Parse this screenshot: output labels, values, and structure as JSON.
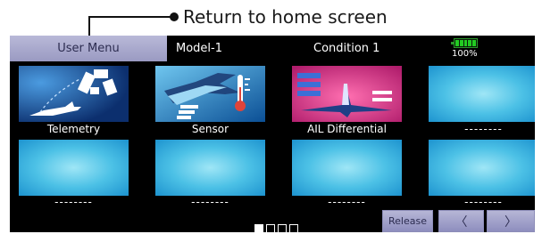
{
  "callout": {
    "text": "Return to home screen"
  },
  "header": {
    "user_menu": "User Menu",
    "model": "Model-1",
    "condition": "Condition 1",
    "battery_percent": "100%",
    "battery_level": 1.0
  },
  "tiles": [
    {
      "label": "Telemetry",
      "icon": "telemetry-icon"
    },
    {
      "label": "Sensor",
      "icon": "sensor-icon"
    },
    {
      "label": "AIL Differential",
      "icon": "ail-differential-icon"
    },
    {
      "label": "--------",
      "icon": ""
    },
    {
      "label": "--------",
      "icon": ""
    },
    {
      "label": "--------",
      "icon": ""
    },
    {
      "label": "--------",
      "icon": ""
    },
    {
      "label": "--------",
      "icon": ""
    }
  ],
  "pager": {
    "pages": 4,
    "current": 1
  },
  "buttons": {
    "release": "Release",
    "prev": "〈",
    "next": "〉"
  }
}
